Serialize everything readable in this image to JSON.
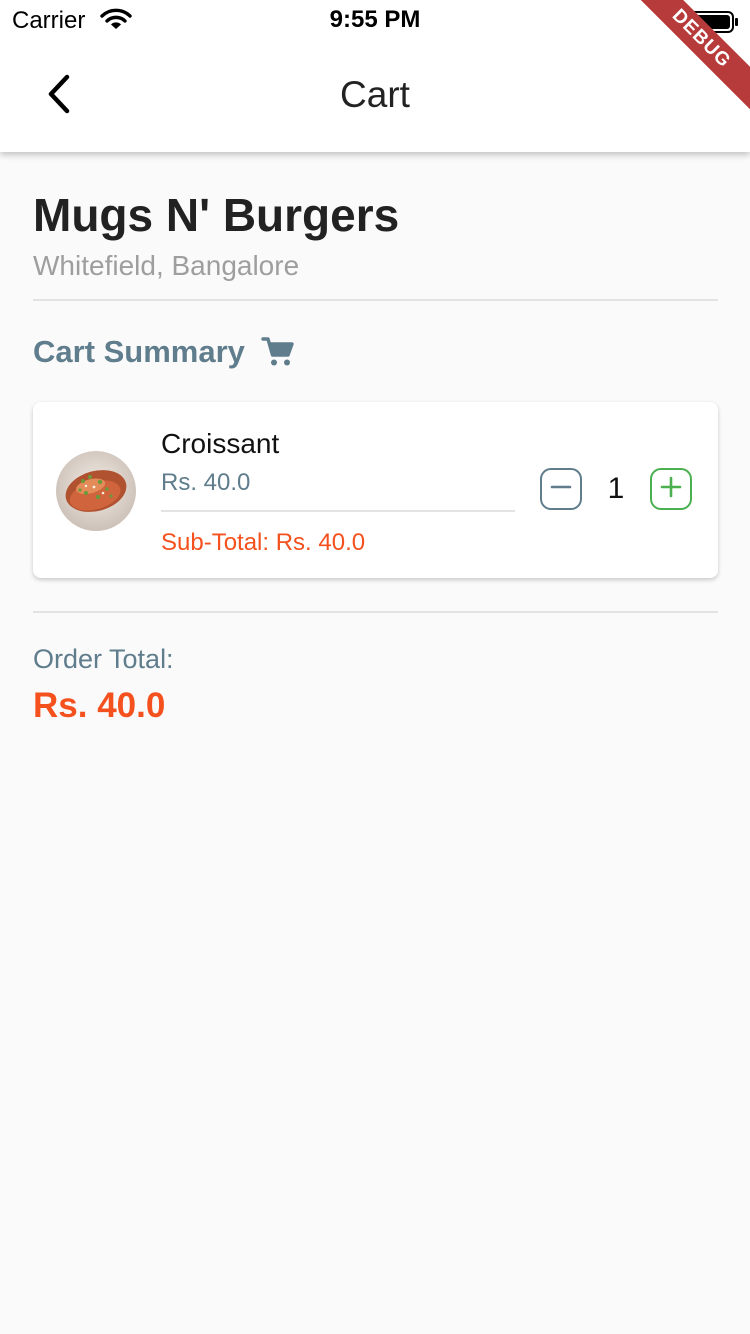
{
  "status_bar": {
    "carrier": "Carrier",
    "time": "9:55 PM"
  },
  "app_bar": {
    "title": "Cart",
    "debug_banner": "DEBUG"
  },
  "restaurant": {
    "name": "Mugs N' Burgers",
    "location": "Whitefield, Bangalore"
  },
  "cart_summary": {
    "title": "Cart Summary",
    "icon": "shopping-cart-icon",
    "items": [
      {
        "name": "Croissant",
        "price": "Rs. 40.0",
        "subtotal": "Sub-Total: Rs. 40.0",
        "quantity": "1",
        "image": "food-thumbnail"
      }
    ]
  },
  "order_total": {
    "label": "Order Total:",
    "value": "Rs. 40.0"
  },
  "colors": {
    "accent_orange": "#f4511e",
    "slate": "#5f7d8c",
    "green": "#4caf50",
    "background": "#fafafa",
    "debug_red": "#b73b3b"
  }
}
